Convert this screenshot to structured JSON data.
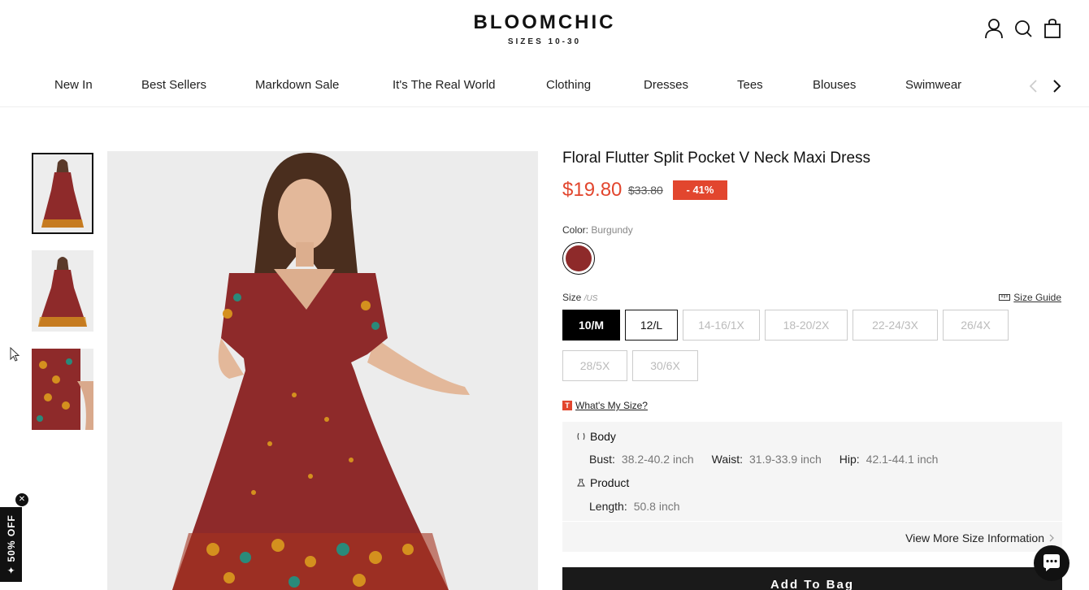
{
  "brand": {
    "name": "BLOOMCHIC",
    "tagline": "SIZES 10-30"
  },
  "header": {
    "icons": [
      "account-icon",
      "search-icon",
      "bag-icon"
    ]
  },
  "nav": {
    "items": [
      "New In",
      "Best Sellers",
      "Markdown Sale",
      "It's The Real World",
      "Clothing",
      "Dresses",
      "Tees",
      "Blouses",
      "Swimwear"
    ]
  },
  "product": {
    "title": "Floral Flutter Split Pocket V Neck Maxi Dress",
    "price": "$19.80",
    "old_price": "$33.80",
    "discount": "- 41%",
    "color_label": "Color:",
    "color_value": "Burgundy",
    "swatch_color": "#8e2a2a",
    "size_label": "Size",
    "size_unit": "/US",
    "size_guide": "Size Guide",
    "sizes": [
      "10/M",
      "12/L",
      "14-16/1X",
      "18-20/2X",
      "22-24/3X",
      "26/4X",
      "28/5X",
      "30/6X"
    ],
    "selected_size": "10/M",
    "whats_my_size_badge": "T",
    "whats_my_size": "What's My Size?",
    "body_title": "Body",
    "bust_label": "Bust:",
    "bust_value": "38.2-40.2 inch",
    "waist_label": "Waist:",
    "waist_value": "31.9-33.9 inch",
    "hip_label": "Hip:",
    "hip_value": "42.1-44.1 inch",
    "product_title": "Product",
    "length_label": "Length:",
    "length_value": "50.8 inch",
    "view_more": "View More Size Information",
    "add_to_bag": "Add To Bag"
  },
  "promo": {
    "label": "✦ 50% OFF",
    "close": "✕"
  },
  "colors": {
    "accent": "#e2462e",
    "dress": "#8e2a2a",
    "floral": "#e0a020"
  }
}
